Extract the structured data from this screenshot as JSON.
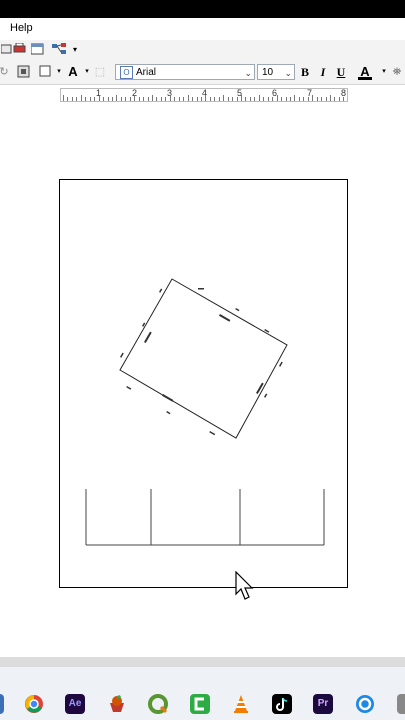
{
  "menu": {
    "help_label": "Help"
  },
  "format": {
    "font_name": "Arial",
    "font_size": "10",
    "bold": "B",
    "italic": "I",
    "underline": "U",
    "font_color": "A"
  },
  "ruler": {
    "labels": [
      "1",
      "2",
      "3",
      "4",
      "5",
      "6",
      "7",
      "8"
    ]
  },
  "colors": {
    "toolbar_bg": "#f3f3f3",
    "taskbar_bg": "#eef1f6"
  },
  "taskbar": {
    "apps": [
      {
        "icon": "chrome-icon"
      },
      {
        "icon": "after-effects-icon",
        "label": "Ae"
      },
      {
        "icon": "cupcake-icon"
      },
      {
        "icon": "qgis-icon"
      },
      {
        "icon": "camtasia-icon"
      },
      {
        "icon": "vlc-icon"
      },
      {
        "icon": "tiktok-icon"
      },
      {
        "icon": "premiere-icon",
        "label": "Pr"
      },
      {
        "icon": "app-icon"
      }
    ]
  }
}
